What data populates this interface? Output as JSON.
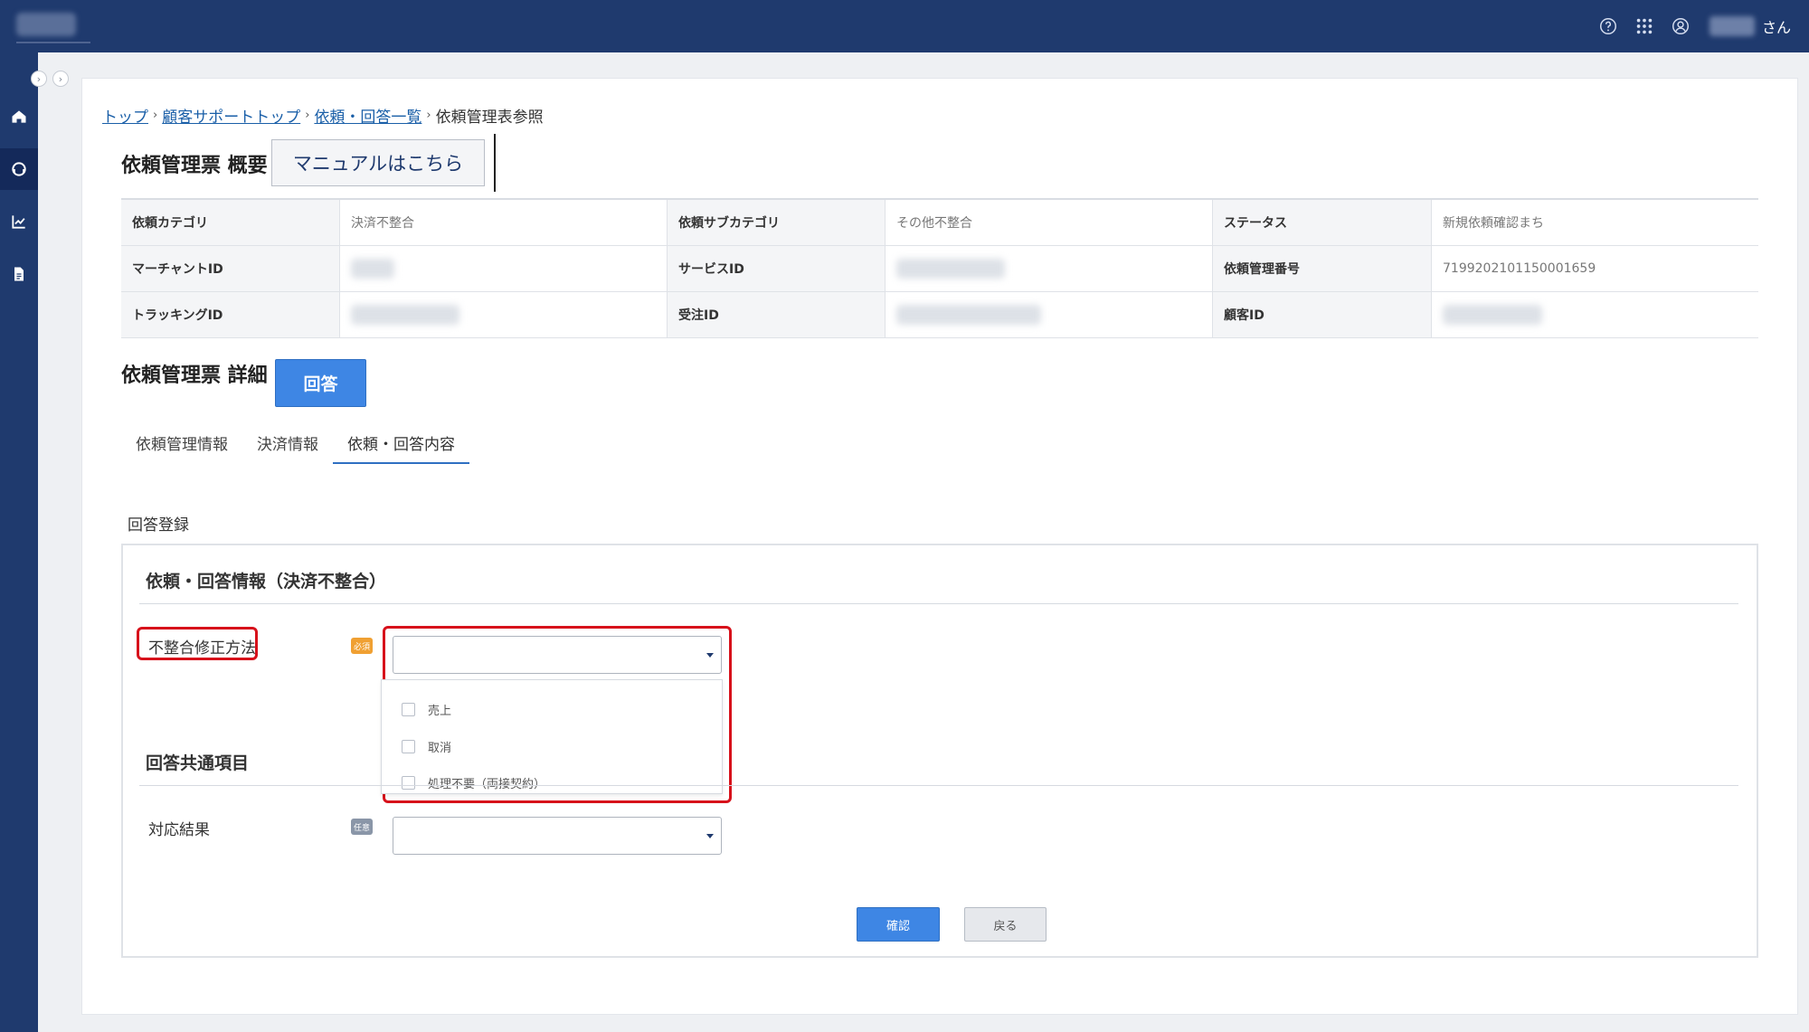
{
  "header": {
    "username_suffix": "さん",
    "icons": [
      "help-icon",
      "apps-grid-icon",
      "user-icon"
    ]
  },
  "sidebar": {
    "items": [
      {
        "name": "home-icon"
      },
      {
        "name": "support-icon",
        "active": true
      },
      {
        "name": "chart-icon"
      },
      {
        "name": "document-icon"
      }
    ]
  },
  "breadcrumb": {
    "items": [
      "トップ",
      "顧客サポートトップ",
      "依頼・回答一覧"
    ],
    "current": "依頼管理表参照"
  },
  "overview": {
    "title": "依頼管理票 概要",
    "manual_button": "マニュアルはこちら",
    "rows": [
      [
        {
          "label": "依頼カテゴリ",
          "value": "決済不整合"
        },
        {
          "label": "依頼サブカテゴリ",
          "value": "その他不整合"
        },
        {
          "label": "ステータス",
          "value": "新規依頼確認まち"
        }
      ],
      [
        {
          "label": "マーチャントID",
          "value": ""
        },
        {
          "label": "サービスID",
          "value": ""
        },
        {
          "label": "依頼管理番号",
          "value": "7199202101150001659"
        }
      ],
      [
        {
          "label": "トラッキングID",
          "value": ""
        },
        {
          "label": "受注ID",
          "value": ""
        },
        {
          "label": "顧客ID",
          "value": ""
        }
      ]
    ]
  },
  "detail": {
    "title": "依頼管理票 詳細",
    "answer_button": "回答",
    "tabs": [
      {
        "label": "依頼管理情報",
        "active": false
      },
      {
        "label": "決済情報",
        "active": false
      },
      {
        "label": "依頼・回答内容",
        "active": true
      }
    ]
  },
  "form": {
    "section_label": "回答登録",
    "group1_title": "依頼・回答情報（決済不整合）",
    "fix_method": {
      "label": "不整合修正方法",
      "badge": "必須",
      "options": [
        "売上",
        "取消",
        "処理不要（両接契約）"
      ]
    },
    "group2_title": "回答共通項目",
    "result": {
      "label": "対応結果",
      "badge": "任意"
    },
    "confirm_button": "確認",
    "back_button": "戻る"
  },
  "colors": {
    "header_bg": "#1f3a6e",
    "primary": "#3e86e4",
    "highlight": "#d7111b",
    "required_badge": "#f0a032"
  }
}
